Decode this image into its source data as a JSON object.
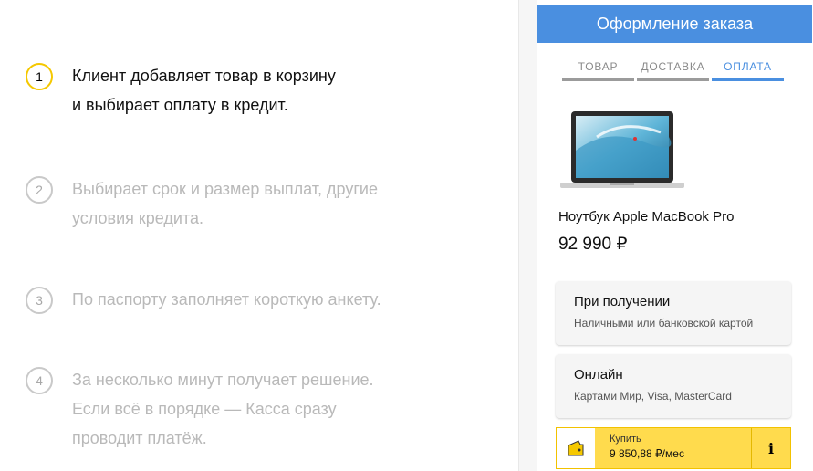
{
  "steps": [
    {
      "num": "1",
      "text": "Клиент добавляет товар в корзину\nи выбирает оплату в кредит.",
      "active": true
    },
    {
      "num": "2",
      "text": "Выбирает срок и размер выплат, другие\nусловия кредита.",
      "active": false
    },
    {
      "num": "3",
      "text": "По паспорту заполняет короткую анкету.",
      "active": false
    },
    {
      "num": "4",
      "text": "За несколько минут получает решение.\nЕсли всё в порядке — Касса сразу\nпроводит платёж.",
      "active": false
    }
  ],
  "checkout": {
    "title": "Оформление заказа",
    "tabs": [
      {
        "label": "ТОВАР",
        "active": false
      },
      {
        "label": "ДОСТАВКА",
        "active": false
      },
      {
        "label": "ОПЛАТА",
        "active": true
      }
    ],
    "product": {
      "name": "Ноутбук Apple MacBook Pro",
      "price": "92 990 ₽",
      "image_icon": "laptop-image"
    },
    "payment_options": [
      {
        "title": "При получении",
        "subtitle": "Наличными или банковской картой"
      },
      {
        "title": "Онлайн",
        "subtitle": "Картами Мир, Visa, MasterCard"
      }
    ],
    "credit": {
      "label": "Купить",
      "amount": "9 850,88 ₽/мес",
      "info": "i",
      "icon": "wallet-icon"
    }
  },
  "colors": {
    "accent_blue": "#4a8fe0",
    "active_step_yellow": "#f5c800",
    "credit_yellow": "#ffdb4d"
  }
}
